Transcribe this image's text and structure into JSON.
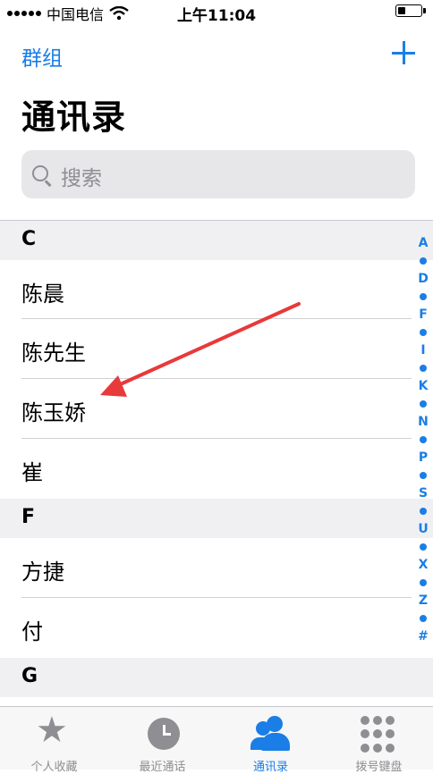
{
  "status_bar": {
    "carrier": "中国电信",
    "time": "上午11:04",
    "battery_level": 0.35
  },
  "nav": {
    "left_label": "群组",
    "add_icon": "plus-icon"
  },
  "title": "通讯录",
  "search": {
    "placeholder": "搜索"
  },
  "sections": [
    {
      "letter": "C",
      "contacts": [
        "陈晨",
        "陈先生",
        "陈玉娇",
        "崔"
      ]
    },
    {
      "letter": "F",
      "contacts": [
        "方捷",
        "付"
      ]
    },
    {
      "letter": "G",
      "contacts": []
    }
  ],
  "index_letters": [
    "A",
    "D",
    "F",
    "I",
    "K",
    "N",
    "P",
    "S",
    "U",
    "X",
    "Z",
    "#"
  ],
  "tab_bar": {
    "tabs": [
      {
        "label": "个人收藏",
        "icon": "star-icon",
        "active": false
      },
      {
        "label": "最近通话",
        "icon": "clock-icon",
        "active": false
      },
      {
        "label": "通讯录",
        "icon": "contacts-icon",
        "active": true
      },
      {
        "label": "拨号键盘",
        "icon": "keypad-icon",
        "active": false
      }
    ]
  },
  "colors": {
    "accent": "#1a7ee6",
    "annotation_arrow": "#e8393b",
    "section_bg": "#f0f0f2"
  }
}
